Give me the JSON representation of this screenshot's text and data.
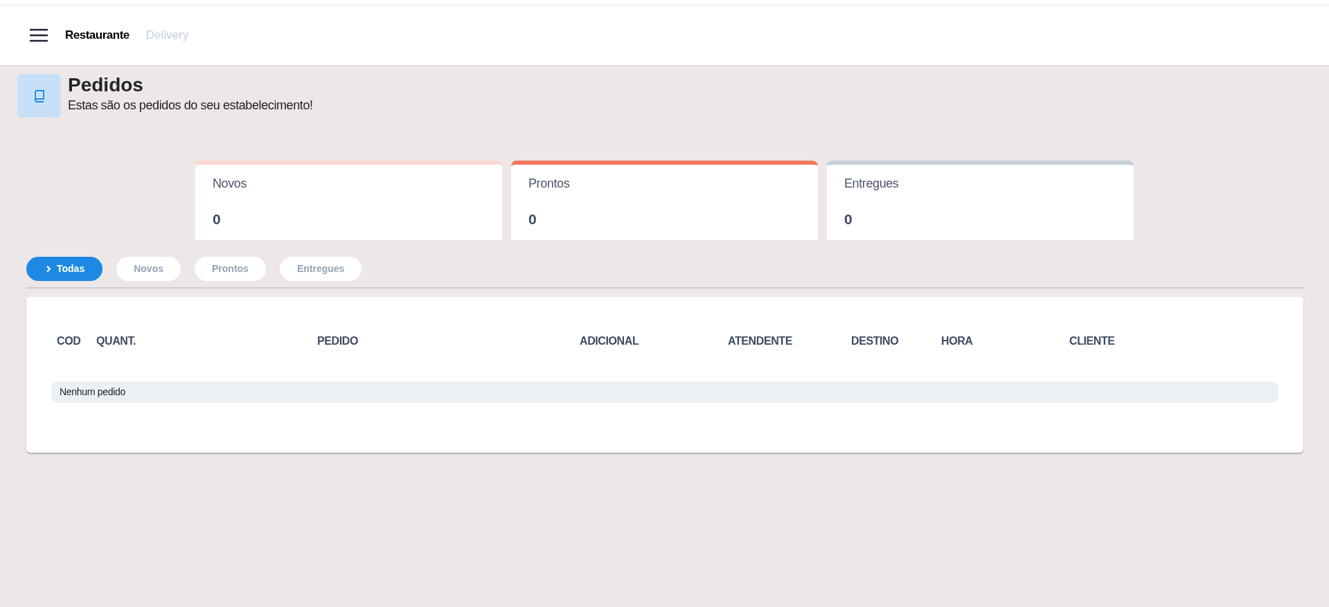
{
  "navbar": {
    "brand": "Restaurante",
    "links": [
      {
        "label": "Delivery",
        "selected": false
      }
    ]
  },
  "header": {
    "title": "Pedidos",
    "subtitle": "Estas são os pedidos do seu estabelecimento!"
  },
  "stats": [
    {
      "label": "Novos",
      "value": "0",
      "color": "#fcd9d0"
    },
    {
      "label": "Prontos",
      "value": "0",
      "color": "#f07a5f"
    },
    {
      "label": "Entregues",
      "value": "0",
      "color": "#c5cfd8"
    }
  ],
  "filters": [
    {
      "label": "Todas",
      "selected": true
    },
    {
      "label": "Novos",
      "selected": false
    },
    {
      "label": "Prontos",
      "selected": false
    },
    {
      "label": "Entregues",
      "selected": false
    }
  ],
  "table": {
    "columns": [
      "COD",
      "QUANT.",
      "PEDIDO",
      "ADICIONAL",
      "ATENDENTE",
      "DESTINO",
      "HORA",
      "CLIENTE"
    ],
    "empty_message": "Nenhum pedido"
  }
}
